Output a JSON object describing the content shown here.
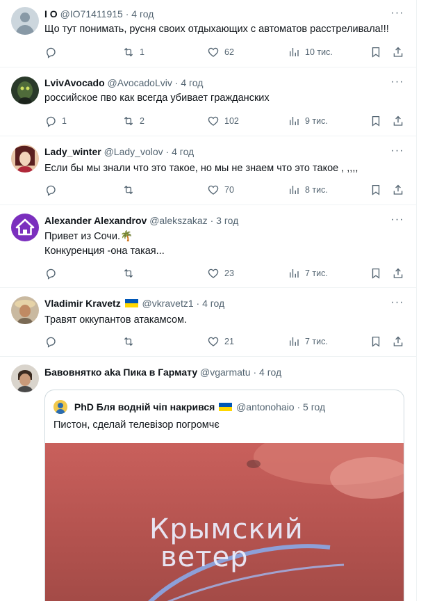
{
  "tweets": [
    {
      "name": "I O",
      "handle": "@IO71411915",
      "time": "4 год",
      "text": [
        "Що тут понимать, русня своих отдыхающих с автоматов расстреливала!!!"
      ],
      "replies": "",
      "retweets": "1",
      "likes": "62",
      "views": "10 тис."
    },
    {
      "name": "LvivAvocado",
      "handle": "@AvocadoLviv",
      "time": "4 год",
      "text": [
        "российское пво как всегда убивает гражданских"
      ],
      "replies": "1",
      "retweets": "2",
      "likes": "102",
      "views": "9 тис."
    },
    {
      "name": "Lady_winter",
      "handle": "@Lady_volov",
      "time": "4 год",
      "text": [
        "Если бы мы знали что это такое, но мы не знаем что это такое , ,,,,"
      ],
      "replies": "",
      "retweets": "",
      "likes": "70",
      "views": "8 тис."
    },
    {
      "name": "Alexander Alexandrov",
      "handle": "@alekszakaz",
      "time": "3 год",
      "text": [
        "Привет из Сочи.🌴",
        "Конкуренция -она такая..."
      ],
      "replies": "",
      "retweets": "",
      "likes": "23",
      "views": "7 тис."
    },
    {
      "name": "Vladimir Kravetz",
      "handle": "@vkravetz1",
      "time": "4 год",
      "text": [
        "Травят оккупантов атакамсом."
      ],
      "replies": "",
      "retweets": "",
      "likes": "21",
      "views": "7 тис."
    },
    {
      "name": "Бавовнятко aka Пика в Гармату",
      "handle": "@vgarmatu",
      "time": "4 год",
      "text": []
    }
  ],
  "quote": {
    "name": "PhD Бля водній чіп накрився",
    "handle": "@antonohaio",
    "time": "5 год",
    "text": "Пистон, сделай телевізор погромчє",
    "media_logo_line1": "Крымский",
    "media_logo_line2": "ветер"
  },
  "ui": {
    "dot": "·",
    "more": "···"
  },
  "colors": {
    "text": "#0f1419",
    "secondary": "#536471",
    "divider": "#eff3f4",
    "flag_blue": "#0057b7",
    "flag_yellow": "#ffd700"
  }
}
